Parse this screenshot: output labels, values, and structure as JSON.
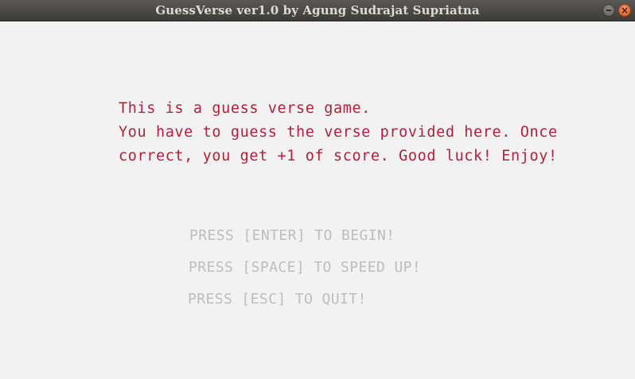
{
  "window": {
    "title": "GuessVerse ver1.0 by Agung Sudrajat Supriatna",
    "minimize_icon": "minimize-icon",
    "close_icon": "close-icon",
    "close_glyph": "×"
  },
  "colors": {
    "intro_text": "#b3203a",
    "prompt_text": "#bdbdbd",
    "background": "#f2f2f2"
  },
  "intro": {
    "line1": "This is a guess verse game.",
    "line2": "You have to guess the verse provided here. Once",
    "line3": "correct, you get +1 of score. Good luck! Enjoy!"
  },
  "prompts": {
    "enter": "PRESS [ENTER] TO BEGIN!",
    "space": "PRESS [SPACE] TO SPEED UP!",
    "esc": "PRESS [ESC] TO QUIT!"
  }
}
